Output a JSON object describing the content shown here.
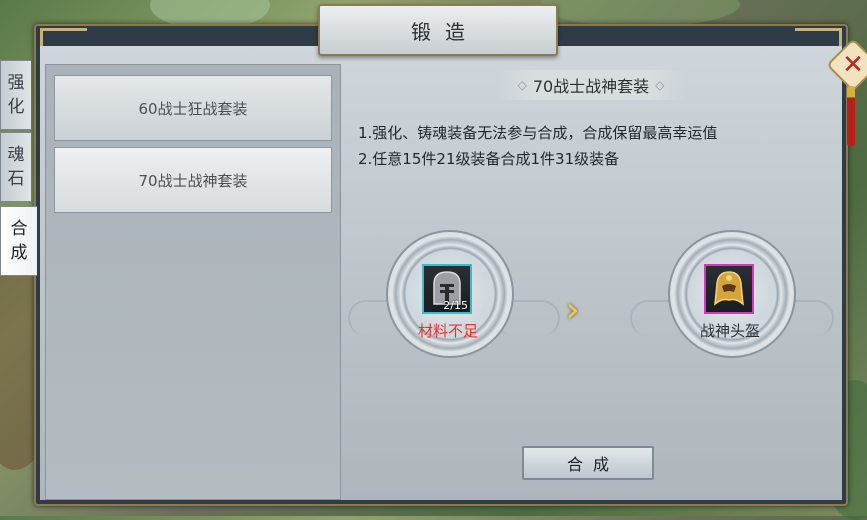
{
  "window": {
    "title": "锻造"
  },
  "tabs": [
    {
      "label_top": "强",
      "label_bottom": "化"
    },
    {
      "label_top": "魂",
      "label_bottom": "石"
    },
    {
      "label_top": "合",
      "label_bottom": "成",
      "active": true
    }
  ],
  "recipe_list": [
    {
      "label": "60战士狂战套装"
    },
    {
      "label": "70战士战神套装",
      "selected": true
    }
  ],
  "detail": {
    "title": "70战士战神套装",
    "rule_1": "1.强化、铸魂装备无法参与合成，合成保留最高幸运值",
    "rule_2": "2.任意15件21级装备合成1件31级装备",
    "input": {
      "icon": "helmet-icon",
      "count": "2/15",
      "status": "材料不足",
      "status_color": "#e8332c",
      "frame_color": "#3fb8c8"
    },
    "output": {
      "icon": "golden-helmet-icon",
      "name": "战神头盔",
      "frame_color": "#c93fb8"
    },
    "craft_button": "合成"
  },
  "colors": {
    "frame_gold": "#8d7a4e",
    "close_red": "#c0281e"
  }
}
